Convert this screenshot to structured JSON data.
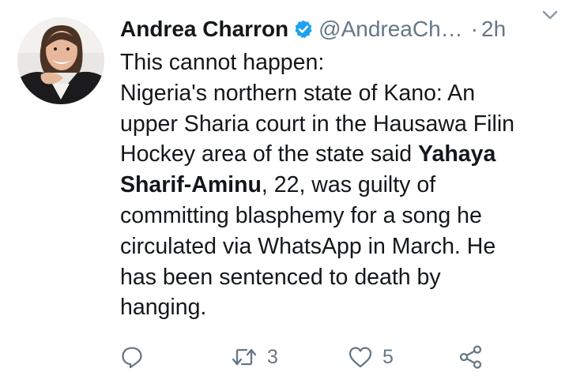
{
  "tweet": {
    "author_name": "Andrea Charron",
    "handle": "@AndreaCh…",
    "separator": "·",
    "time": "2h",
    "verified": true,
    "body": {
      "line1": "This cannot happen:",
      "line2": "Nigeria's northern state of Kano: An",
      "line3": "upper Sharia court in the Hausawa Filin",
      "line4_pre": "Hockey area of the state said ",
      "line4_bold": "Yahaya",
      "line5_bold": "Sharif-Aminu",
      "line5_post": ", 22, was guilty of",
      "line6": "committing blasphemy for a song he",
      "line7": "circulated via WhatsApp in March.  He",
      "line8": "has been sentenced to death by",
      "line9": "hanging."
    },
    "actions": {
      "reply_icon": "reply-icon",
      "retweet_icon": "retweet-icon",
      "retweet_count": "3",
      "like_icon": "heart-icon",
      "like_count": "5",
      "share_icon": "share-icon"
    }
  },
  "colors": {
    "text": "#14171a",
    "secondary": "#657786",
    "verified_badge": "#1da1f2"
  }
}
